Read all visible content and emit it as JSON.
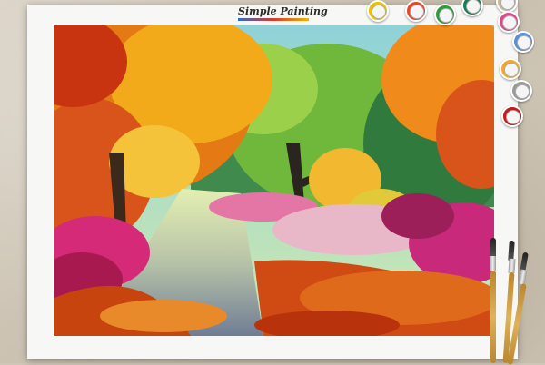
{
  "brand": {
    "name": "Simple Painting"
  },
  "colors": {
    "board": "#f7f7f5",
    "background": "#cfc6b8",
    "accent_blue": "#2c6ec9",
    "accent_red": "#d83a2a",
    "accent_yellow": "#f2b500"
  },
  "paint_pots": [
    {
      "label": "",
      "color": "#e8c200"
    },
    {
      "label": "",
      "color": "#e24a2c"
    },
    {
      "label": "",
      "color": "#2e9a3c"
    },
    {
      "label": "",
      "color": "#1d7a56"
    },
    {
      "label": "",
      "color": "#c7b99e"
    },
    {
      "label": "",
      "color": "#d84b8a"
    },
    {
      "label": "",
      "color": "#5a8fd0"
    },
    {
      "label": "",
      "color": "#f0a830"
    },
    {
      "label": "",
      "color": "#9a9a9a"
    },
    {
      "label": "",
      "color": "#c21d1d"
    }
  ],
  "icons": [
    "paint-pot-icon",
    "paintbrush-icon"
  ]
}
